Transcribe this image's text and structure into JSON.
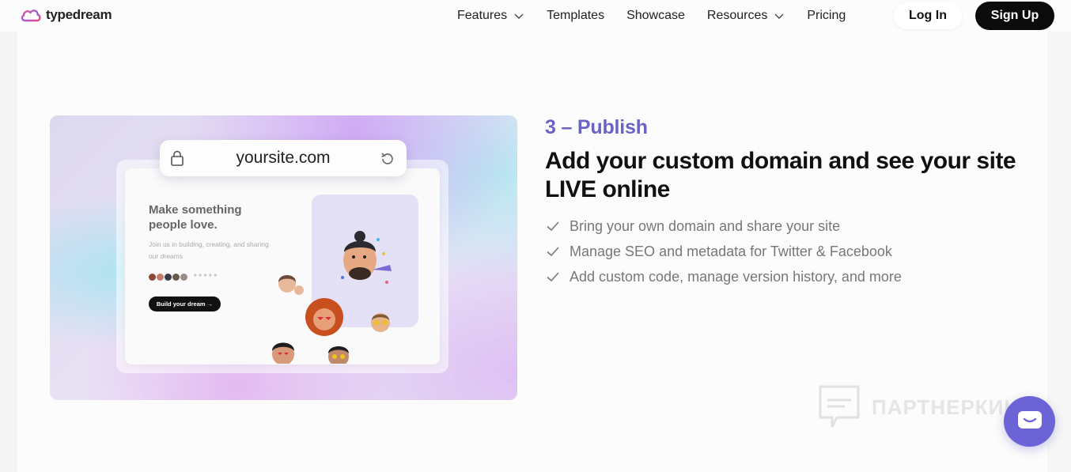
{
  "nav": {
    "brand": "typedream",
    "links": [
      {
        "label": "Features",
        "dropdown": true
      },
      {
        "label": "Templates",
        "dropdown": false
      },
      {
        "label": "Showcase",
        "dropdown": false
      },
      {
        "label": "Resources",
        "dropdown": true
      },
      {
        "label": "Pricing",
        "dropdown": false
      }
    ],
    "login_label": "Log In",
    "signup_label": "Sign Up"
  },
  "hero_image": {
    "url_text": "yoursite.com",
    "mock_title": "Make something people love.",
    "mock_subtitle": "Join us in building, creating, and sharing our dreams",
    "mock_button": "Build your dream →"
  },
  "section": {
    "step_label": "3 – Publish",
    "headline": "Add your custom domain and see your site LIVE online",
    "features": [
      "Bring your own domain and share your site",
      "Manage SEO and metadata for Twitter & Facebook",
      "Add custom code, manage version history, and more"
    ]
  },
  "watermark": {
    "text": "ПАРТНЕРКИН"
  },
  "colors": {
    "accent": "#6b63c4",
    "chat_button": "#6b63d6",
    "signup_bg": "#0b0b0b"
  }
}
